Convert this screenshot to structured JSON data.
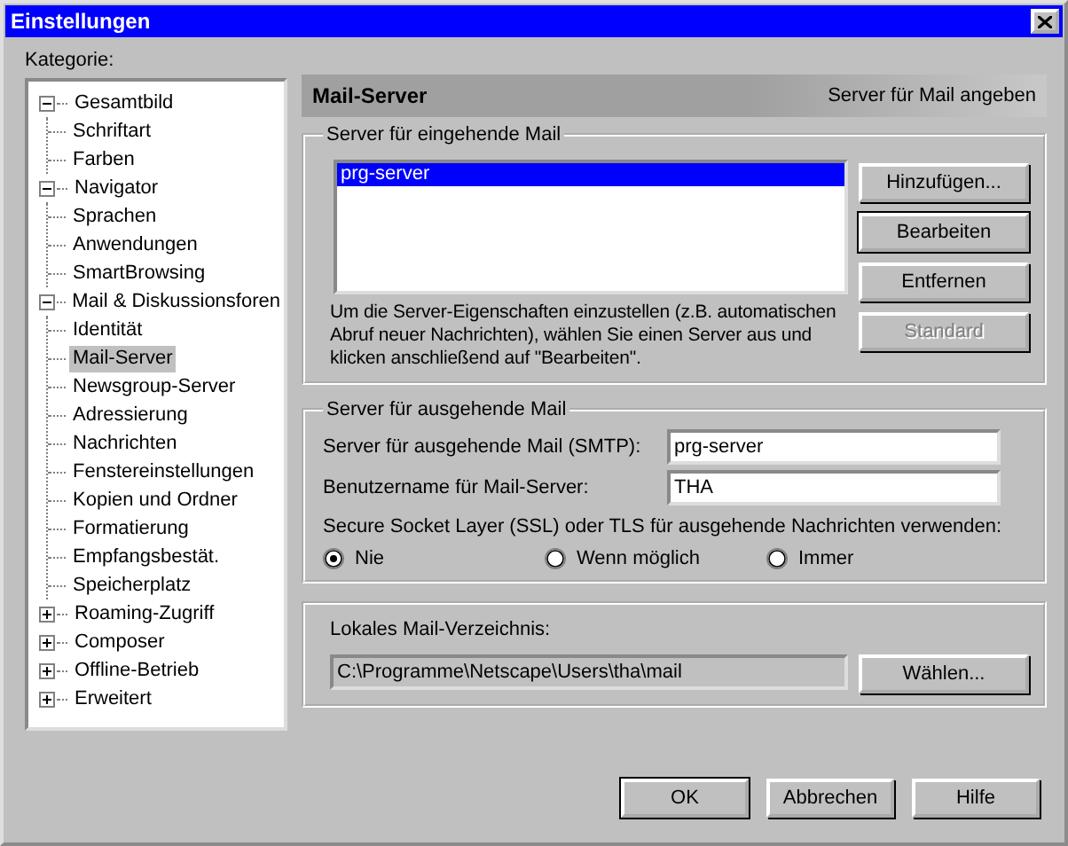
{
  "window": {
    "title": "Einstellungen"
  },
  "category_label": "Kategorie:",
  "tree": [
    {
      "label": "Gesamtbild",
      "expanded": true,
      "selected": false,
      "children": [
        {
          "label": "Schriftart",
          "selected": false
        },
        {
          "label": "Farben",
          "selected": false
        }
      ]
    },
    {
      "label": "Navigator",
      "expanded": true,
      "selected": false,
      "children": [
        {
          "label": "Sprachen",
          "selected": false
        },
        {
          "label": "Anwendungen",
          "selected": false
        },
        {
          "label": "SmartBrowsing",
          "selected": false
        }
      ]
    },
    {
      "label": "Mail & Diskussionsforen",
      "expanded": true,
      "selected": false,
      "children": [
        {
          "label": "Identität",
          "selected": false
        },
        {
          "label": "Mail-Server",
          "selected": true
        },
        {
          "label": "Newsgroup-Server",
          "selected": false
        },
        {
          "label": "Adressierung",
          "selected": false
        },
        {
          "label": "Nachrichten",
          "selected": false
        },
        {
          "label": "Fenstereinstellungen",
          "selected": false
        },
        {
          "label": "Kopien und Ordner",
          "selected": false
        },
        {
          "label": "Formatierung",
          "selected": false
        },
        {
          "label": "Empfangsbestät.",
          "selected": false
        },
        {
          "label": "Speicherplatz",
          "selected": false
        }
      ]
    },
    {
      "label": "Roaming-Zugriff",
      "expanded": false,
      "selected": false
    },
    {
      "label": "Composer",
      "expanded": false,
      "selected": false
    },
    {
      "label": "Offline-Betrieb",
      "expanded": false,
      "selected": false
    },
    {
      "label": "Erweitert",
      "expanded": false,
      "selected": false
    }
  ],
  "header": {
    "title": "Mail-Server",
    "subtitle": "Server für Mail angeben"
  },
  "incoming": {
    "legend": "Server für eingehende Mail",
    "servers": [
      {
        "label": "prg-server",
        "selected": true
      }
    ],
    "buttons": [
      {
        "label": "Hinzufügen...",
        "disabled": false,
        "default": false
      },
      {
        "label": "Bearbeiten",
        "disabled": false,
        "default": true
      },
      {
        "label": "Entfernen",
        "disabled": false,
        "default": false
      },
      {
        "label": "Standard",
        "disabled": true,
        "default": false
      }
    ],
    "hint": "Um die Server-Eigenschaften einzustellen (z.B. automatischen Abruf neuer Nachrichten), wählen Sie einen Server aus und klicken anschließend auf \"Bearbeiten\"."
  },
  "outgoing": {
    "legend": "Server für ausgehende Mail",
    "fields": [
      {
        "label": "Server für ausgehende Mail (SMTP):",
        "value": "prg-server"
      },
      {
        "label": "Benutzername für Mail-Server:",
        "value": "THA"
      }
    ],
    "ssl_label": "Secure Socket Layer (SSL) oder TLS für ausgehende Nachrichten verwenden:",
    "options": [
      {
        "label": "Nie",
        "selected": true
      },
      {
        "label": "Wenn möglich",
        "selected": false
      },
      {
        "label": "Immer",
        "selected": false
      }
    ]
  },
  "local": {
    "label": "Lokales Mail-Verzeichnis:",
    "path": "C:\\Programme\\Netscape\\Users\\tha\\mail",
    "button": "Wählen..."
  },
  "buttons": [
    {
      "label": "OK",
      "default": true
    },
    {
      "label": "Abbrechen",
      "default": false
    },
    {
      "label": "Hilfe",
      "default": false
    }
  ]
}
